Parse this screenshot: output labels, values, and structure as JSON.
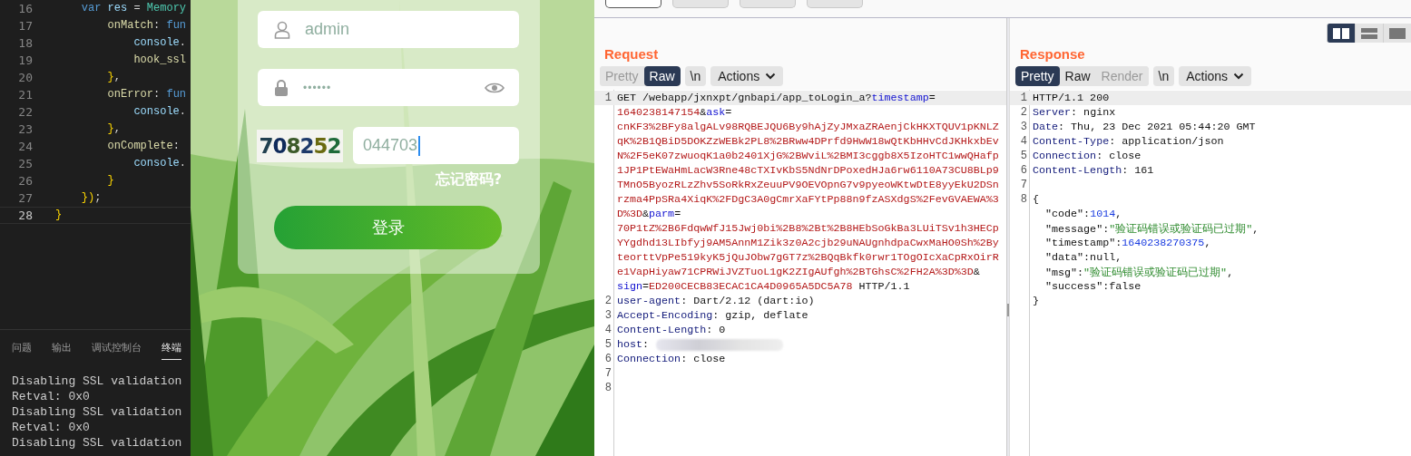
{
  "editor": {
    "code_lines": [
      {
        "number": "16",
        "selected": false,
        "tokens": [
          {
            "kind": "keyword",
            "text": "    var"
          },
          {
            "kind": "variable",
            "text": " res"
          },
          {
            "kind": "punct",
            "text": " = "
          },
          {
            "kind": "class",
            "text": "Memory"
          }
        ]
      },
      {
        "number": "17",
        "selected": false,
        "tokens": [
          {
            "kind": "function",
            "text": "        onMatch"
          },
          {
            "kind": "punct",
            "text": ": "
          },
          {
            "kind": "keyword",
            "text": "fun"
          }
        ]
      },
      {
        "number": "18",
        "selected": false,
        "tokens": [
          {
            "kind": "variable",
            "text": "            console"
          },
          {
            "kind": "punct",
            "text": "."
          }
        ]
      },
      {
        "number": "19",
        "selected": false,
        "tokens": [
          {
            "kind": "function",
            "text": "            hook_ssl"
          }
        ]
      },
      {
        "number": "20",
        "selected": false,
        "tokens": [
          {
            "kind": "brace",
            "text": "        }"
          },
          {
            "kind": "punct",
            "text": ","
          }
        ]
      },
      {
        "number": "21",
        "selected": false,
        "tokens": [
          {
            "kind": "function",
            "text": "        onError"
          },
          {
            "kind": "punct",
            "text": ": "
          },
          {
            "kind": "keyword",
            "text": "fun"
          }
        ]
      },
      {
        "number": "22",
        "selected": false,
        "tokens": [
          {
            "kind": "variable",
            "text": "            console"
          },
          {
            "kind": "punct",
            "text": "."
          }
        ]
      },
      {
        "number": "23",
        "selected": false,
        "tokens": [
          {
            "kind": "brace",
            "text": "        }"
          },
          {
            "kind": "punct",
            "text": ","
          }
        ]
      },
      {
        "number": "24",
        "selected": false,
        "tokens": [
          {
            "kind": "function",
            "text": "        onComplete"
          },
          {
            "kind": "punct",
            "text": ":"
          }
        ]
      },
      {
        "number": "25",
        "selected": false,
        "tokens": [
          {
            "kind": "variable",
            "text": "            console"
          },
          {
            "kind": "punct",
            "text": "."
          }
        ]
      },
      {
        "number": "26",
        "selected": false,
        "tokens": [
          {
            "kind": "brace",
            "text": "        }"
          }
        ]
      },
      {
        "number": "27",
        "selected": false,
        "tokens": [
          {
            "kind": "brace",
            "text": "    })"
          },
          {
            "kind": "punct",
            "text": ";"
          }
        ]
      },
      {
        "number": "28",
        "selected": true,
        "tokens": [
          {
            "kind": "brace",
            "text": "}"
          }
        ]
      }
    ]
  },
  "panel": {
    "tabs": [
      {
        "label": "问题",
        "selected": false
      },
      {
        "label": "输出",
        "selected": false
      },
      {
        "label": "调试控制台",
        "selected": false
      },
      {
        "label": "终端",
        "selected": true
      }
    ],
    "terminal_lines": [
      "Disabling SSL validation",
      "Retval: 0x0",
      "Disabling SSL validation",
      "Retval: 0x0",
      "Disabling SSL validation"
    ]
  },
  "login": {
    "username": "admin",
    "password": "••••••",
    "captcha": "708252",
    "captcha_input": "044703",
    "forgot_link": "忘记密码?",
    "login_button": "登录"
  },
  "request": {
    "title": "Request",
    "view_tabs": [
      {
        "label": "Pretty",
        "selected": false,
        "disabled": true
      },
      {
        "label": "Raw",
        "selected": true,
        "disabled": false
      }
    ],
    "newline_button": "\\n",
    "actions_button": "Actions",
    "lines": [
      {
        "number": "1",
        "selected": true,
        "rows": [
          {
            "runs": [
              {
                "kind": "plain",
                "text": "GET /webapp/jxnxpt/gnbapi/app_toLogin_a?"
              },
              {
                "kind": "param",
                "text": "timestamp"
              },
              {
                "kind": "plain",
                "text": "="
              }
            ]
          },
          {
            "runs": [
              {
                "kind": "value",
                "text": "1640238147154"
              },
              {
                "kind": "plain",
                "text": "&"
              },
              {
                "kind": "param",
                "text": "ask"
              },
              {
                "kind": "plain",
                "text": "="
              }
            ]
          },
          {
            "runs": [
              {
                "kind": "value",
                "text": "cnKF3%2BFy8algALv98RQBEJQU6By9hAjZyJMxaZRAenjCkHKXTQUV1pKNLZ"
              }
            ]
          },
          {
            "runs": [
              {
                "kind": "value",
                "text": "qK%2B1QBiD5DOKZzWEBk2PL8%2BRww4DPrfd9HwW18wQtKbHHvCdJKHkxbEv"
              }
            ]
          },
          {
            "runs": [
              {
                "kind": "value",
                "text": "N%2F5eK07zwuoqK1a0b2401XjG%2BWviL%2BMI3cggb8X5IzoHTC1wwQHafp"
              }
            ]
          },
          {
            "runs": [
              {
                "kind": "value",
                "text": "1JP1PtEWaHmLacW3Rne48cTXIvKbS5NdNrDPoxedHJa6rw6110A73CU8BLp9"
              }
            ]
          },
          {
            "runs": [
              {
                "kind": "value",
                "text": "TMnO5ByozRLzZhv5SoRkRxZeuuPV9OEVOpnG7v9pyeoWKtwDtE8yyEkU2DSn"
              }
            ]
          },
          {
            "runs": [
              {
                "kind": "value",
                "text": "rzma4PpSRa4XiqK%2FDgC3A0gCmrXaFYtPp88n9fzASXdgS%2FevGVAEWA%3"
              }
            ]
          },
          {
            "runs": [
              {
                "kind": "value",
                "text": "D%3D"
              },
              {
                "kind": "plain",
                "text": "&"
              },
              {
                "kind": "param",
                "text": "parm"
              },
              {
                "kind": "plain",
                "text": "="
              }
            ]
          },
          {
            "runs": [
              {
                "kind": "value",
                "text": "70P1tZ%2B6FdqwWfJ15Jwj0bi%2B8%2Bt%2B8HEbSoGkBa3LUiTSv1h3HECp"
              }
            ]
          },
          {
            "runs": [
              {
                "kind": "value",
                "text": "YYgdhd13LIbfyj9AM5AnnM1Zik3z0A2cjb29uNAUgnhdpaCwxMaHO0Sh%2By"
              }
            ]
          },
          {
            "runs": [
              {
                "kind": "value",
                "text": "teorttVpPe519kyK5jQuJObw7gGT7z%2BQqBkfk0rwr1TOgOIcXaCpRxOirR"
              }
            ]
          },
          {
            "runs": [
              {
                "kind": "value",
                "text": "e1VapHiyaw71CPRWiJVZTuoL1gK2ZIgAUfgh%2BTGhsC%2FH2A%3D%3D"
              },
              {
                "kind": "plain",
                "text": "&"
              }
            ]
          },
          {
            "runs": [
              {
                "kind": "param",
                "text": "sign"
              },
              {
                "kind": "plain",
                "text": "="
              },
              {
                "kind": "value",
                "text": "ED200CECB83ECAC1CA4D0965A5DC5A78"
              },
              {
                "kind": "plain",
                "text": " HTTP/1.1"
              }
            ]
          }
        ]
      },
      {
        "number": "2",
        "selected": false,
        "rows": [
          {
            "runs": [
              {
                "kind": "header",
                "text": "user-agent"
              },
              {
                "kind": "plain",
                "text": ": Dart/2.12 (dart:io)"
              }
            ]
          }
        ]
      },
      {
        "number": "3",
        "selected": false,
        "rows": [
          {
            "runs": [
              {
                "kind": "header",
                "text": "Accept-Encoding"
              },
              {
                "kind": "plain",
                "text": ": gzip, deflate"
              }
            ]
          }
        ]
      },
      {
        "number": "4",
        "selected": false,
        "rows": [
          {
            "runs": [
              {
                "kind": "header",
                "text": "Content-Length"
              },
              {
                "kind": "plain",
                "text": ": 0"
              }
            ]
          }
        ]
      },
      {
        "number": "5",
        "selected": false,
        "redacted": true,
        "rows": [
          {
            "runs": [
              {
                "kind": "header",
                "text": "host"
              },
              {
                "kind": "plain",
                "text": ":"
              }
            ]
          }
        ]
      },
      {
        "number": "6",
        "selected": false,
        "rows": [
          {
            "runs": [
              {
                "kind": "header",
                "text": "Connection"
              },
              {
                "kind": "plain",
                "text": ": close"
              }
            ]
          }
        ]
      },
      {
        "number": "7",
        "selected": false,
        "rows": [
          {}
        ]
      },
      {
        "number": "8",
        "selected": false,
        "rows": [
          {}
        ]
      }
    ]
  },
  "response": {
    "title": "Response",
    "layout_buttons": [
      {
        "kind": "columns",
        "selected": true
      },
      {
        "kind": "rows",
        "selected": false
      },
      {
        "kind": "single",
        "selected": false
      }
    ],
    "view_tabs": [
      {
        "label": "Pretty",
        "selected": true,
        "disabled": false
      },
      {
        "label": "Raw",
        "selected": false,
        "disabled": false
      },
      {
        "label": "Render",
        "selected": false,
        "disabled": true
      }
    ],
    "newline_button": "\\n",
    "actions_button": "Actions",
    "lines": [
      {
        "number": "1",
        "selected": true,
        "rows": [
          {
            "runs": [
              {
                "kind": "plain",
                "text": "HTTP/1.1 200"
              }
            ]
          }
        ]
      },
      {
        "number": "2",
        "selected": false,
        "rows": [
          {
            "runs": [
              {
                "kind": "header",
                "text": "Server"
              },
              {
                "kind": "plain",
                "text": ": nginx"
              }
            ]
          }
        ]
      },
      {
        "number": "3",
        "selected": false,
        "rows": [
          {
            "runs": [
              {
                "kind": "header",
                "text": "Date"
              },
              {
                "kind": "plain",
                "text": ": Thu, 23 Dec 2021 05:44:20 GMT"
              }
            ]
          }
        ]
      },
      {
        "number": "4",
        "selected": false,
        "rows": [
          {
            "runs": [
              {
                "kind": "header",
                "text": "Content-Type"
              },
              {
                "kind": "plain",
                "text": ": application/json"
              }
            ]
          }
        ]
      },
      {
        "number": "5",
        "selected": false,
        "rows": [
          {
            "runs": [
              {
                "kind": "header",
                "text": "Connection"
              },
              {
                "kind": "plain",
                "text": ": close"
              }
            ]
          }
        ]
      },
      {
        "number": "6",
        "selected": false,
        "rows": [
          {
            "runs": [
              {
                "kind": "header",
                "text": "Content-Length"
              },
              {
                "kind": "plain",
                "text": ": 161"
              }
            ]
          }
        ]
      },
      {
        "number": "7",
        "selected": false,
        "rows": [
          {}
        ]
      },
      {
        "number": "8",
        "selected": false,
        "rows": [
          {
            "runs": [
              {
                "kind": "plain",
                "text": "{"
              }
            ]
          },
          {
            "runs": [
              {
                "kind": "plain",
                "text": "  \"code\":"
              },
              {
                "kind": "number",
                "text": "1014"
              },
              {
                "kind": "plain",
                "text": ","
              }
            ]
          },
          {
            "runs": [
              {
                "kind": "plain",
                "text": "  \"message\":"
              },
              {
                "kind": "string",
                "text": "\"验证码错误或验证码已过期\""
              },
              {
                "kind": "plain",
                "text": ","
              }
            ]
          },
          {
            "runs": [
              {
                "kind": "plain",
                "text": "  \"timestamp\":"
              },
              {
                "kind": "number",
                "text": "1640238270375"
              },
              {
                "kind": "plain",
                "text": ","
              }
            ]
          },
          {
            "runs": [
              {
                "kind": "plain",
                "text": "  \"data\":null,"
              }
            ]
          },
          {
            "runs": [
              {
                "kind": "plain",
                "text": "  \"msg\":"
              },
              {
                "kind": "string",
                "text": "\"验证码错误或验证码已过期\""
              },
              {
                "kind": "plain",
                "text": ","
              }
            ]
          },
          {
            "runs": [
              {
                "kind": "plain",
                "text": "  \"success\":false"
              }
            ]
          },
          {
            "runs": [
              {
                "kind": "plain",
                "text": "}"
              }
            ]
          }
        ]
      }
    ]
  }
}
